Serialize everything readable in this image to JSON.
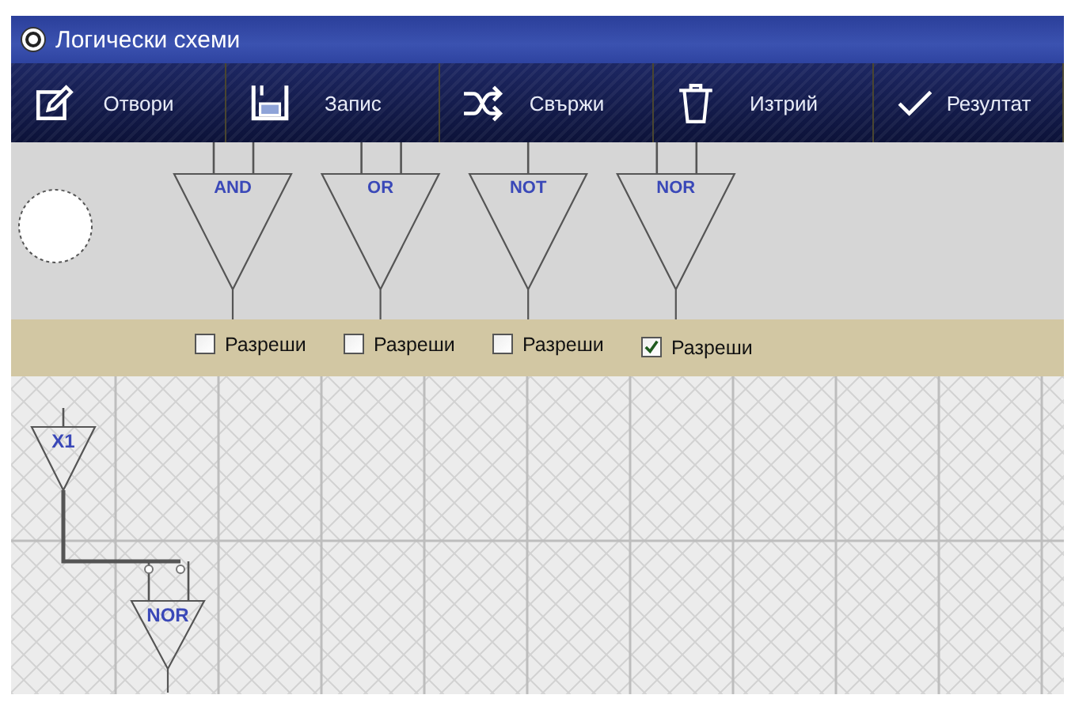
{
  "window": {
    "title": "Логически схеми"
  },
  "toolbar": [
    {
      "label": "Отвори",
      "kind": "edit"
    },
    {
      "label": "Запис",
      "kind": "save"
    },
    {
      "label": "Свържи",
      "kind": "shuffle"
    },
    {
      "label": "Изтрий",
      "kind": "trash"
    },
    {
      "label": "Резултат",
      "kind": "check"
    }
  ],
  "palette": [
    {
      "label": "AND",
      "kind": "two_input",
      "enable": {
        "label": "Разреши",
        "checked": false
      }
    },
    {
      "label": "OR",
      "kind": "two_input",
      "enable": {
        "label": "Разреши",
        "checked": false
      }
    },
    {
      "label": "NOT",
      "kind": "one_input",
      "enable": {
        "label": "Разреши",
        "checked": false
      }
    },
    {
      "label": "NOR",
      "kind": "two_input",
      "enable": {
        "label": "Разреши",
        "checked": true
      }
    }
  ],
  "canvas": {
    "nodes": [
      {
        "label": "X1",
        "kind": "input"
      },
      {
        "label": "NOR",
        "kind": "gate"
      }
    ]
  }
}
